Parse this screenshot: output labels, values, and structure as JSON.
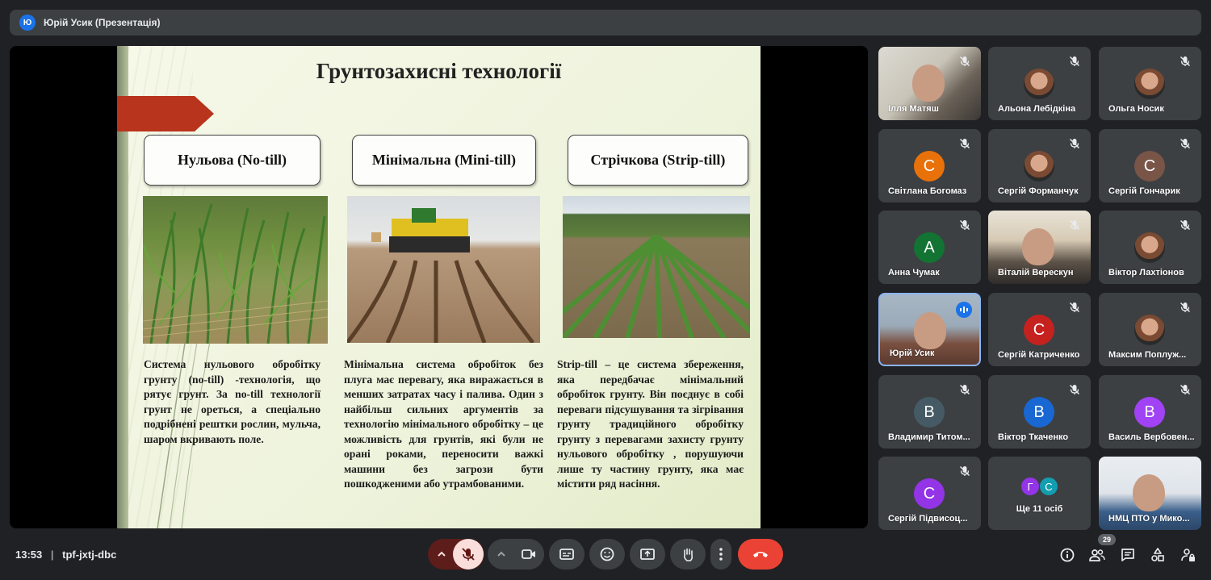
{
  "presenter_bar": {
    "avatar_letter": "Ю",
    "title": "Юрій Усик (Презентація)"
  },
  "slide": {
    "title": "Грунтозахисні технології",
    "columns": [
      {
        "heading": "Нульова (No-till)",
        "text": "Система нульового обробітку грунту (no-till) -технологія, що рятує грунт. За no-till технології грунт не ореться, а спеціально подрібнені рештки рослин, мульча, шаром вкривають поле."
      },
      {
        "heading": "Мінімальна (Mini-till)",
        "text": "Мінімальна система обробіток без плуга має перевагу, яка виражається в менших затратах часу і палива. Один з найбільш сильних аргументів за технологію мінімального обробітку – це можливість для грунтів, які були не орані роками, переносити важкі машини без загрози бути пошкодженими або утрамбованими."
      },
      {
        "heading": "Стрічкова (Strip-till)",
        "text": "Strip-till – це система збереження, яка передбачає мінімальний обробіток грунту. Він поєднує в собі переваги підсушування та зігрівання грунту традиційного обробітку грунту з перевагами захисту грунту нульового обробітку , порушуючи лише ту частину грунту, яка має містити ряд насіння."
      }
    ]
  },
  "participants": [
    {
      "name": "Ілля Матяш",
      "type": "video"
    },
    {
      "name": "Альона Лебідкіна",
      "type": "photo"
    },
    {
      "name": "Ольга Носик",
      "type": "photo"
    },
    {
      "name": "Світлана Богомаз",
      "type": "letter",
      "letter": "С",
      "color": "#e8710a"
    },
    {
      "name": "Сергій Форманчук",
      "type": "photo"
    },
    {
      "name": "Сергій Гончарик",
      "type": "letter",
      "letter": "С",
      "color": "#795548"
    },
    {
      "name": "Анна Чумак",
      "type": "letter",
      "letter": "А",
      "color": "#137333"
    },
    {
      "name": "Віталій Верескун",
      "type": "video"
    },
    {
      "name": "Віктор Лахтіонов",
      "type": "photo"
    },
    {
      "name": "Юрій Усик",
      "type": "video"
    },
    {
      "name": "Сергій Катриченко",
      "type": "letter",
      "letter": "С",
      "color": "#c5221f"
    },
    {
      "name": "Максим Поплуж...",
      "type": "photo"
    },
    {
      "name": "Владимир Титом...",
      "type": "letter",
      "letter": "В",
      "color": "#455a64"
    },
    {
      "name": "Віктор Ткаченко",
      "type": "letter",
      "letter": "В",
      "color": "#1967d2"
    },
    {
      "name": "Василь Вербовен...",
      "type": "letter",
      "letter": "В",
      "color": "#a142f4"
    },
    {
      "name": "Сергій Підвисоц...",
      "type": "letter",
      "letter": "С",
      "color": "#9334e6"
    },
    {
      "name": "Ще 11 осіб",
      "type": "more",
      "letters": [
        "Г",
        "С"
      ],
      "colors": [
        "#9334e6",
        "#129eaf"
      ]
    },
    {
      "name": "НМЦ ПТО у Мико...",
      "type": "video"
    }
  ],
  "meeting": {
    "time": "13:53",
    "separator": "|",
    "code": "tpf-jxtj-dbc",
    "people_count": "29"
  },
  "icons": {
    "mic_off": "mic-off-icon",
    "camera": "videocam-icon",
    "captions": "captions-icon",
    "emoji": "emoji-icon",
    "present": "present-icon",
    "hand": "hand-icon",
    "more": "more-vert-icon",
    "end": "call-end-icon"
  },
  "colors": {
    "end_call": "#ea4335",
    "mic_off_bg": "#f9dedc",
    "accent": "#8ab4f8"
  }
}
